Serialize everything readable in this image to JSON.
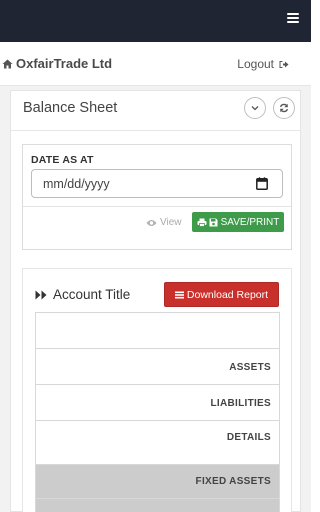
{
  "app": {
    "brand_name": "OxfairTrade Ltd"
  },
  "header": {
    "logout_label": "Logout"
  },
  "page": {
    "title": "Balance Sheet"
  },
  "form": {
    "date_label": "DATE AS AT",
    "date_placeholder": "mm/dd/yyyy",
    "view_label": "View",
    "save_print_label": "SAVE/PRINT"
  },
  "report": {
    "section_title": "Account Title",
    "download_label": "Download Report",
    "rows": [
      "ASSETS",
      "LIABILITIES",
      "DETAILS",
      "FIXED ASSETS"
    ]
  },
  "colors": {
    "topbar": "#1f2532",
    "save_button": "#3d9b4a",
    "download_button": "#c9302c",
    "highlight_row": "#cccccc"
  }
}
